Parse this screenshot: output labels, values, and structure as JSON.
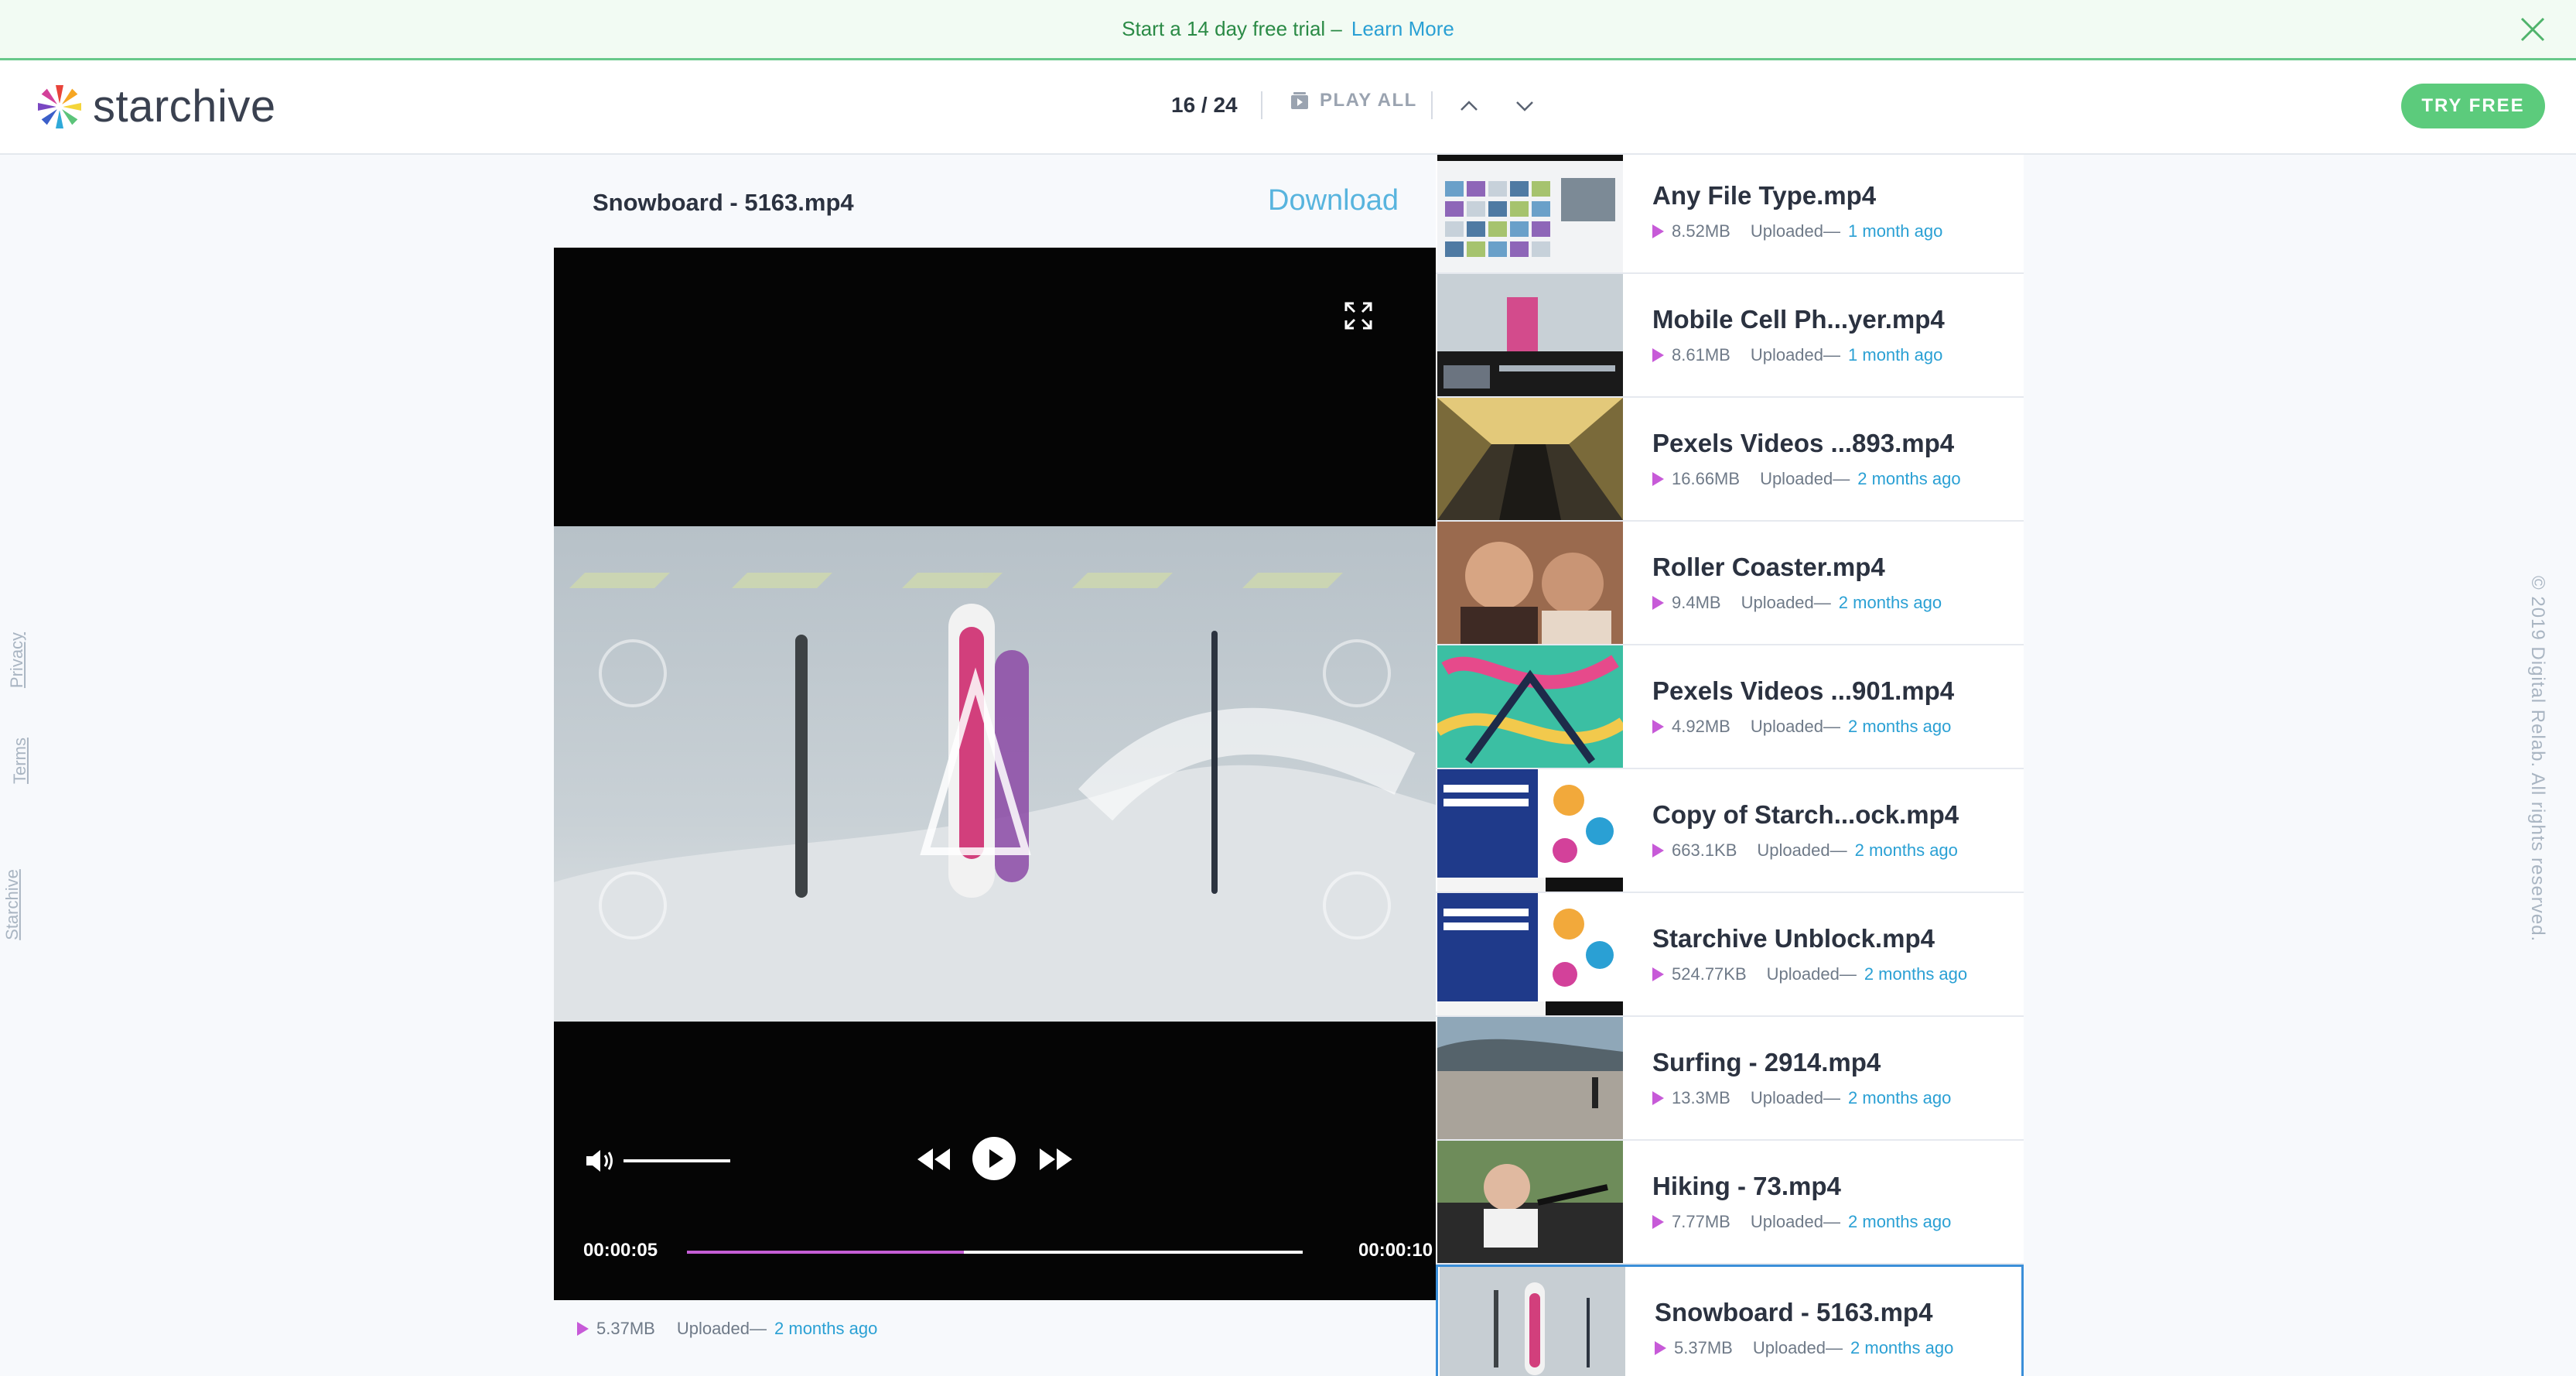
{
  "banner": {
    "lead": "Start a 14 day free trial –",
    "link": "Learn More",
    "close_icon": "close-icon"
  },
  "header": {
    "brand": "starchive",
    "counter": "16 / 24",
    "play_all": "PLAY ALL",
    "try_free": "TRY FREE"
  },
  "left_rail": {
    "privacy": "Privacy",
    "terms": "Terms",
    "starchive": "Starchive"
  },
  "right_rail": {
    "copyright": "© 2019 Digital Relab. All rights reserved."
  },
  "viewer": {
    "title": "Snowboard - 5163.mp4",
    "download": "Download",
    "time_current": "00:00:05",
    "time_total": "00:00:10",
    "progress": 0.45,
    "volume": 1.0,
    "size": "5.37MB",
    "uploaded_label": "Uploaded—",
    "uploaded_ago": "2 months ago"
  },
  "playlist": [
    {
      "name": "Any File Type.mp4",
      "size": "8.52MB",
      "uploaded_label": "Uploaded—",
      "ago": "1 month ago",
      "thumb": "grid"
    },
    {
      "name": "Mobile Cell Ph...yer.mp4",
      "size": "8.61MB",
      "uploaded_label": "Uploaded—",
      "ago": "1 month ago",
      "thumb": "mobile"
    },
    {
      "name": "Pexels Videos ...893.mp4",
      "size": "16.66MB",
      "uploaded_label": "Uploaded—",
      "ago": "2 months ago",
      "thumb": "corridor"
    },
    {
      "name": "Roller Coaster.mp4",
      "size": "9.4MB",
      "uploaded_label": "Uploaded—",
      "ago": "2 months ago",
      "thumb": "people"
    },
    {
      "name": "Pexels Videos ...901.mp4",
      "size": "4.92MB",
      "uploaded_label": "Uploaded—",
      "ago": "2 months ago",
      "thumb": "graffiti"
    },
    {
      "name": "Copy of Starch...ock.mp4",
      "size": "663.1KB",
      "uploaded_label": "Uploaded—",
      "ago": "2 months ago",
      "thumb": "ad"
    },
    {
      "name": "Starchive Unblock.mp4",
      "size": "524.77KB",
      "uploaded_label": "Uploaded—",
      "ago": "2 months ago",
      "thumb": "ad"
    },
    {
      "name": "Surfing - 2914.mp4",
      "size": "13.3MB",
      "uploaded_label": "Uploaded—",
      "ago": "2 months ago",
      "thumb": "beach"
    },
    {
      "name": "Hiking - 73.mp4",
      "size": "7.77MB",
      "uploaded_label": "Uploaded—",
      "ago": "2 months ago",
      "thumb": "car"
    },
    {
      "name": "Snowboard - 5163.mp4",
      "size": "5.37MB",
      "uploaded_label": "Uploaded—",
      "ago": "2 months ago",
      "thumb": "snow",
      "active": true
    }
  ],
  "colors": {
    "accent_green": "#5ccb7c",
    "link_blue": "#2aa0d4",
    "progress_magenta": "#c55ed6",
    "active_border": "#3b8fd9"
  }
}
